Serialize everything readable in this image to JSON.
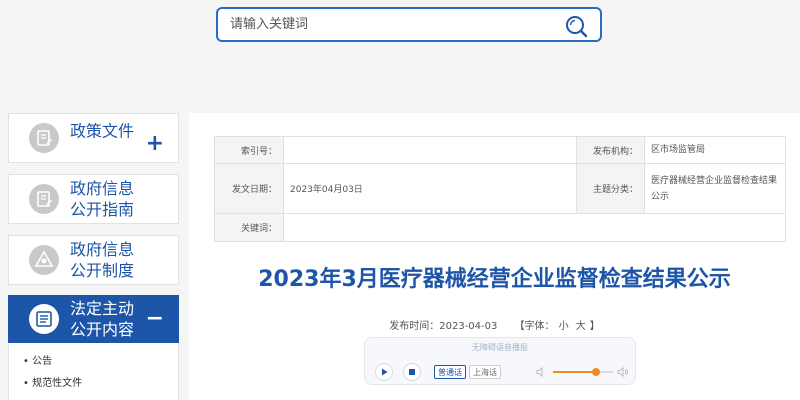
{
  "search": {
    "placeholder": "请输入关键词",
    "value": ""
  },
  "sidebar": {
    "items": [
      {
        "label": "政策文件",
        "toggle": "+",
        "icon": "document-icon"
      },
      {
        "label": "政府信息\n公开指南",
        "toggle": "",
        "icon": "guide-icon"
      },
      {
        "label": "政府信息\n公开制度",
        "toggle": "",
        "icon": "system-icon"
      },
      {
        "label": "法定主动\n公开内容",
        "toggle": "−",
        "icon": "list-icon"
      }
    ],
    "subitems": [
      "• 公告",
      "• 规范性文件"
    ]
  },
  "meta": {
    "index_label": "索引号：",
    "index_value": "",
    "org_label": "发布机构：",
    "org_value": "区市场监管局",
    "date_label": "发文日期：",
    "date_value": "2023年04月03日",
    "topic_label": "主题分类：",
    "topic_value": "医疗器械经营企业监督检查结果公示",
    "keyword_label": "关键词：",
    "keyword_value": ""
  },
  "article": {
    "title": "2023年3月医疗器械经营企业监督检查结果公示",
    "pub_label": "发布时间：2023-04-03",
    "font_open": "【字体：",
    "font_small": "小",
    "font_large": "大",
    "font_close": "】"
  },
  "player": {
    "title": "无障碍语音播报",
    "lang_mandarin": "普通话",
    "lang_shanghai": "上海话",
    "volume": 0.72
  },
  "colors": {
    "accent": "#1d56a8",
    "volume": "#f08a24"
  }
}
